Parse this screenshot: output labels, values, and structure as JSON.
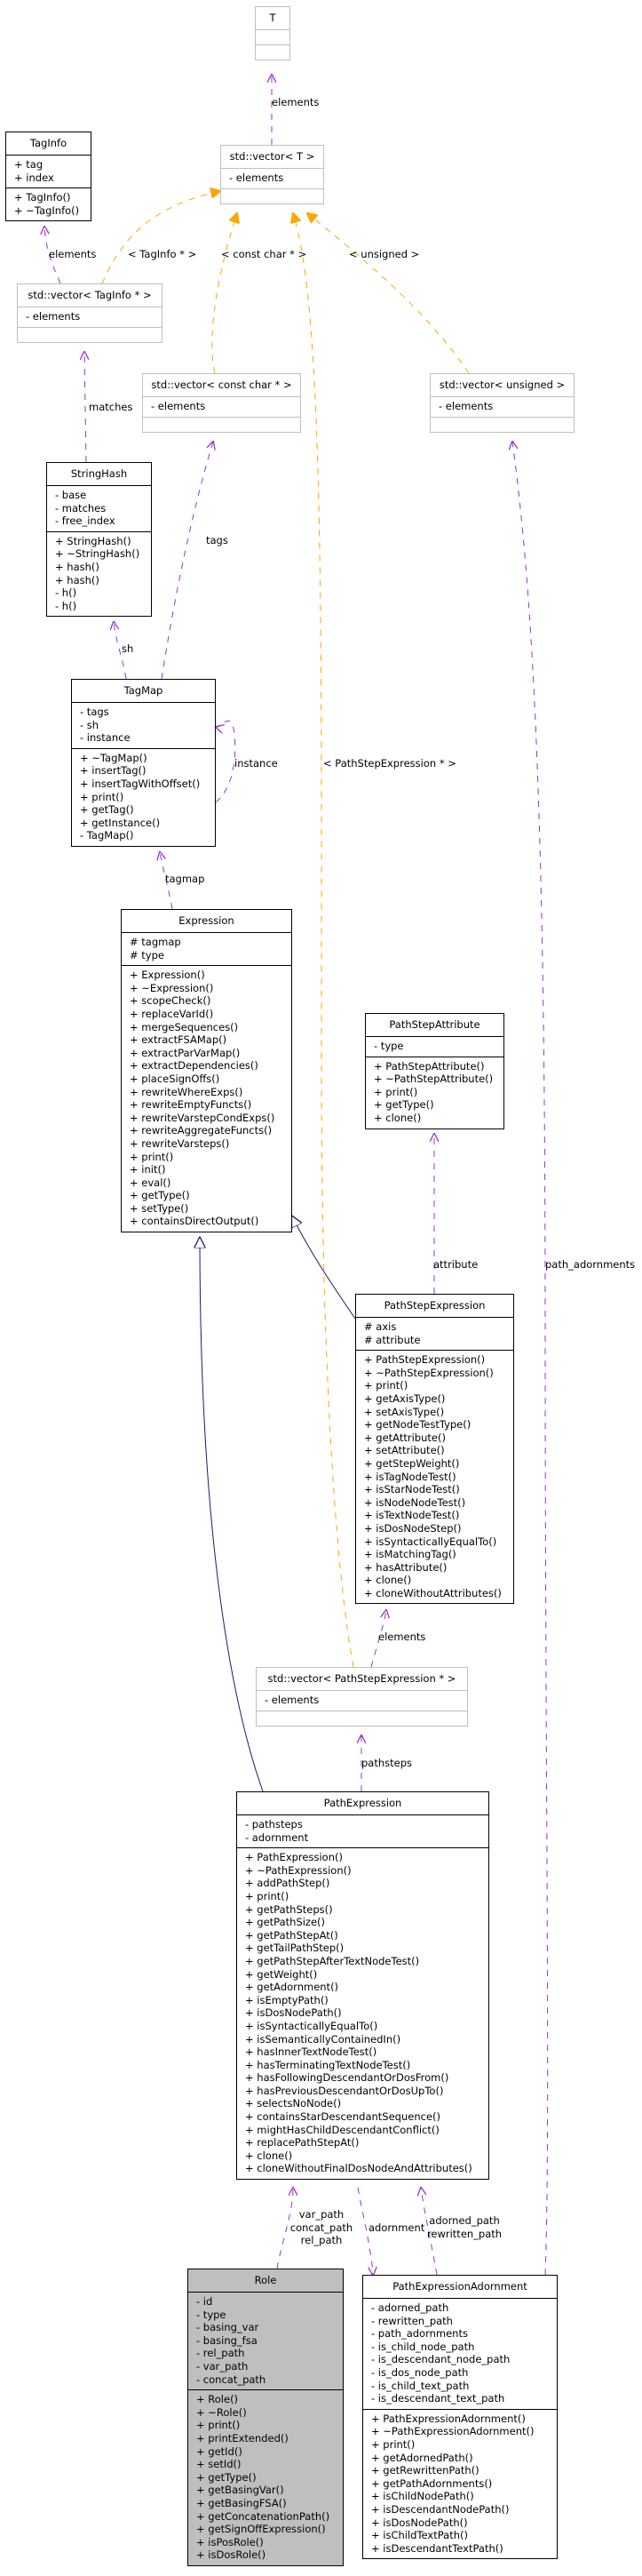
{
  "classes": {
    "T": {
      "name": "T",
      "attributes": [],
      "methods": []
    },
    "vectorT": {
      "name": "std::vector< T >",
      "attributes": [
        "- elements"
      ],
      "methods": []
    },
    "TagInfo": {
      "name": "TagInfo",
      "attributes": [
        "+ tag",
        "+ index"
      ],
      "methods": [
        "+ TagInfo()",
        "+ ~TagInfo()"
      ]
    },
    "vectorTagInfo": {
      "name": "std::vector< TagInfo * >",
      "attributes": [
        "- elements"
      ],
      "methods": []
    },
    "vectorConstChar": {
      "name": "std::vector< const char * >",
      "attributes": [
        "- elements"
      ],
      "methods": []
    },
    "vectorUnsigned": {
      "name": "std::vector< unsigned >",
      "attributes": [
        "- elements"
      ],
      "methods": []
    },
    "StringHash": {
      "name": "StringHash",
      "attributes": [
        "- base",
        "- matches",
        "- free_index"
      ],
      "methods": [
        "+ StringHash()",
        "+ ~StringHash()",
        "+ hash()",
        "+ hash()",
        "- h()",
        "- h()"
      ]
    },
    "TagMap": {
      "name": "TagMap",
      "attributes": [
        "- tags",
        "- sh",
        "- instance"
      ],
      "methods": [
        "+ ~TagMap()",
        "+ insertTag()",
        "+ insertTagWithOffset()",
        "+ print()",
        "+ getTag()",
        "+ getInstance()",
        "- TagMap()"
      ]
    },
    "Expression": {
      "name": "Expression",
      "attributes": [
        "# tagmap",
        "# type"
      ],
      "methods": [
        "+ Expression()",
        "+ ~Expression()",
        "+ scopeCheck()",
        "+ replaceVarId()",
        "+ mergeSequences()",
        "+ extractFSAMap()",
        "+ extractParVarMap()",
        "+ extractDependencies()",
        "+ placeSignOffs()",
        "+ rewriteWhereExps()",
        "+ rewriteEmptyFuncts()",
        "+ rewriteVarstepCondExps()",
        "+ rewriteAggregateFuncts()",
        "+ rewriteVarsteps()",
        "+ print()",
        "+ init()",
        "+ eval()",
        "+ getType()",
        "+ setType()",
        "+ containsDirectOutput()"
      ]
    },
    "PathStepAttribute": {
      "name": "PathStepAttribute",
      "attributes": [
        "- type"
      ],
      "methods": [
        "+ PathStepAttribute()",
        "+ ~PathStepAttribute()",
        "+ print()",
        "+ getType()",
        "+ clone()"
      ]
    },
    "PathStepExpression": {
      "name": "PathStepExpression",
      "attributes": [
        "# axis",
        "# attribute"
      ],
      "methods": [
        "+ PathStepExpression()",
        "+ ~PathStepExpression()",
        "+ print()",
        "+ getAxisType()",
        "+ setAxisType()",
        "+ getNodeTestType()",
        "+ getAttribute()",
        "+ setAttribute()",
        "+ getStepWeight()",
        "+ isTagNodeTest()",
        "+ isStarNodeTest()",
        "+ isNodeNodeTest()",
        "+ isTextNodeTest()",
        "+ isDosNodeStep()",
        "+ isSyntacticallyEqualTo()",
        "+ isMatchingTag()",
        "+ hasAttribute()",
        "+ clone()",
        "+ cloneWithoutAttributes()"
      ]
    },
    "vectorPathStep": {
      "name": "std::vector< PathStepExpression * >",
      "attributes": [
        "- elements"
      ],
      "methods": []
    },
    "PathExpression": {
      "name": "PathExpression",
      "attributes": [
        "- pathsteps",
        "- adornment"
      ],
      "methods": [
        "+ PathExpression()",
        "+ ~PathExpression()",
        "+ addPathStep()",
        "+ print()",
        "+ getPathSteps()",
        "+ getPathSize()",
        "+ getPathStepAt()",
        "+ getTailPathStep()",
        "+ getPathStepAfterTextNodeTest()",
        "+ getWeight()",
        "+ getAdornment()",
        "+ isEmptyPath()",
        "+ isDosNodePath()",
        "+ isSyntacticallyEqualTo()",
        "+ isSemanticallyContainedIn()",
        "+ hasInnerTextNodeTest()",
        "+ hasTerminatingTextNodeTest()",
        "+ hasFollowingDescendantOrDosFrom()",
        "+ hasPreviousDescendantOrDosUpTo()",
        "+ selectsNoNode()",
        "+ containsStarDescendantSequence()",
        "+ mightHasChildDescendantConflict()",
        "+ replacePathStepAt()",
        "+ clone()",
        "+ cloneWithoutFinalDosNodeAndAttributes()"
      ]
    },
    "Role": {
      "name": "Role",
      "attributes": [
        "- id",
        "- type",
        "- basing_var",
        "- basing_fsa",
        "- rel_path",
        "- var_path",
        "- concat_path"
      ],
      "methods": [
        "+ Role()",
        "+ ~Role()",
        "+ print()",
        "+ printExtended()",
        "+ getId()",
        "+ setId()",
        "+ getType()",
        "+ getBasingVar()",
        "+ getBasingFSA()",
        "+ getConcatenationPath()",
        "+ getSignOffExpression()",
        "+ isPosRole()",
        "+ isDosRole()"
      ]
    },
    "PathExpressionAdornment": {
      "name": "PathExpressionAdornment",
      "attributes": [
        "- adorned_path",
        "- rewritten_path",
        "- path_adornments",
        "- is_child_node_path",
        "- is_descendant_node_path",
        "- is_dos_node_path",
        "- is_child_text_path",
        "- is_descendant_text_path"
      ],
      "methods": [
        "+ PathExpressionAdornment()",
        "+ ~PathExpressionAdornment()",
        "+ print()",
        "+ getAdornedPath()",
        "+ getRewrittenPath()",
        "+ getPathAdornments()",
        "+ isChildNodePath()",
        "+ isDescendantNodePath()",
        "+ isDosNodePath()",
        "+ isChildTextPath()",
        "+ isDescendantTextPath()"
      ]
    }
  },
  "edge_labels": {
    "vectorT_T": "elements",
    "vectorTagInfo_TagInfo": "elements",
    "tmpl_taginfo": "< TagInfo * >",
    "tmpl_constchar": "< const char * >",
    "tmpl_unsigned": "< unsigned >",
    "tmpl_pathstep": "< PathStepExpression * >",
    "stringhash_matches": "matches",
    "tagmap_tags": "tags",
    "tagmap_sh": "sh",
    "tagmap_instance": "instance",
    "expression_tagmap": "tagmap",
    "pathstep_attribute": "attribute",
    "vectorPathStep_elements": "elements",
    "pathexpr_pathsteps": "pathsteps",
    "adornment_path_adornments": "path_adornments",
    "role_paths": [
      "var_path",
      "concat_path",
      "rel_path"
    ],
    "pathexpr_adornment": "adornment",
    "adornment_paths": [
      "adorned_path",
      "rewritten_path"
    ]
  },
  "colors": {
    "usage_edge": "#9a32cd",
    "template_edge": "#ffa500",
    "inheritance_edge": "#191970",
    "focus_fill": "#bfbfbf",
    "template_border": "#bfbfbf"
  }
}
